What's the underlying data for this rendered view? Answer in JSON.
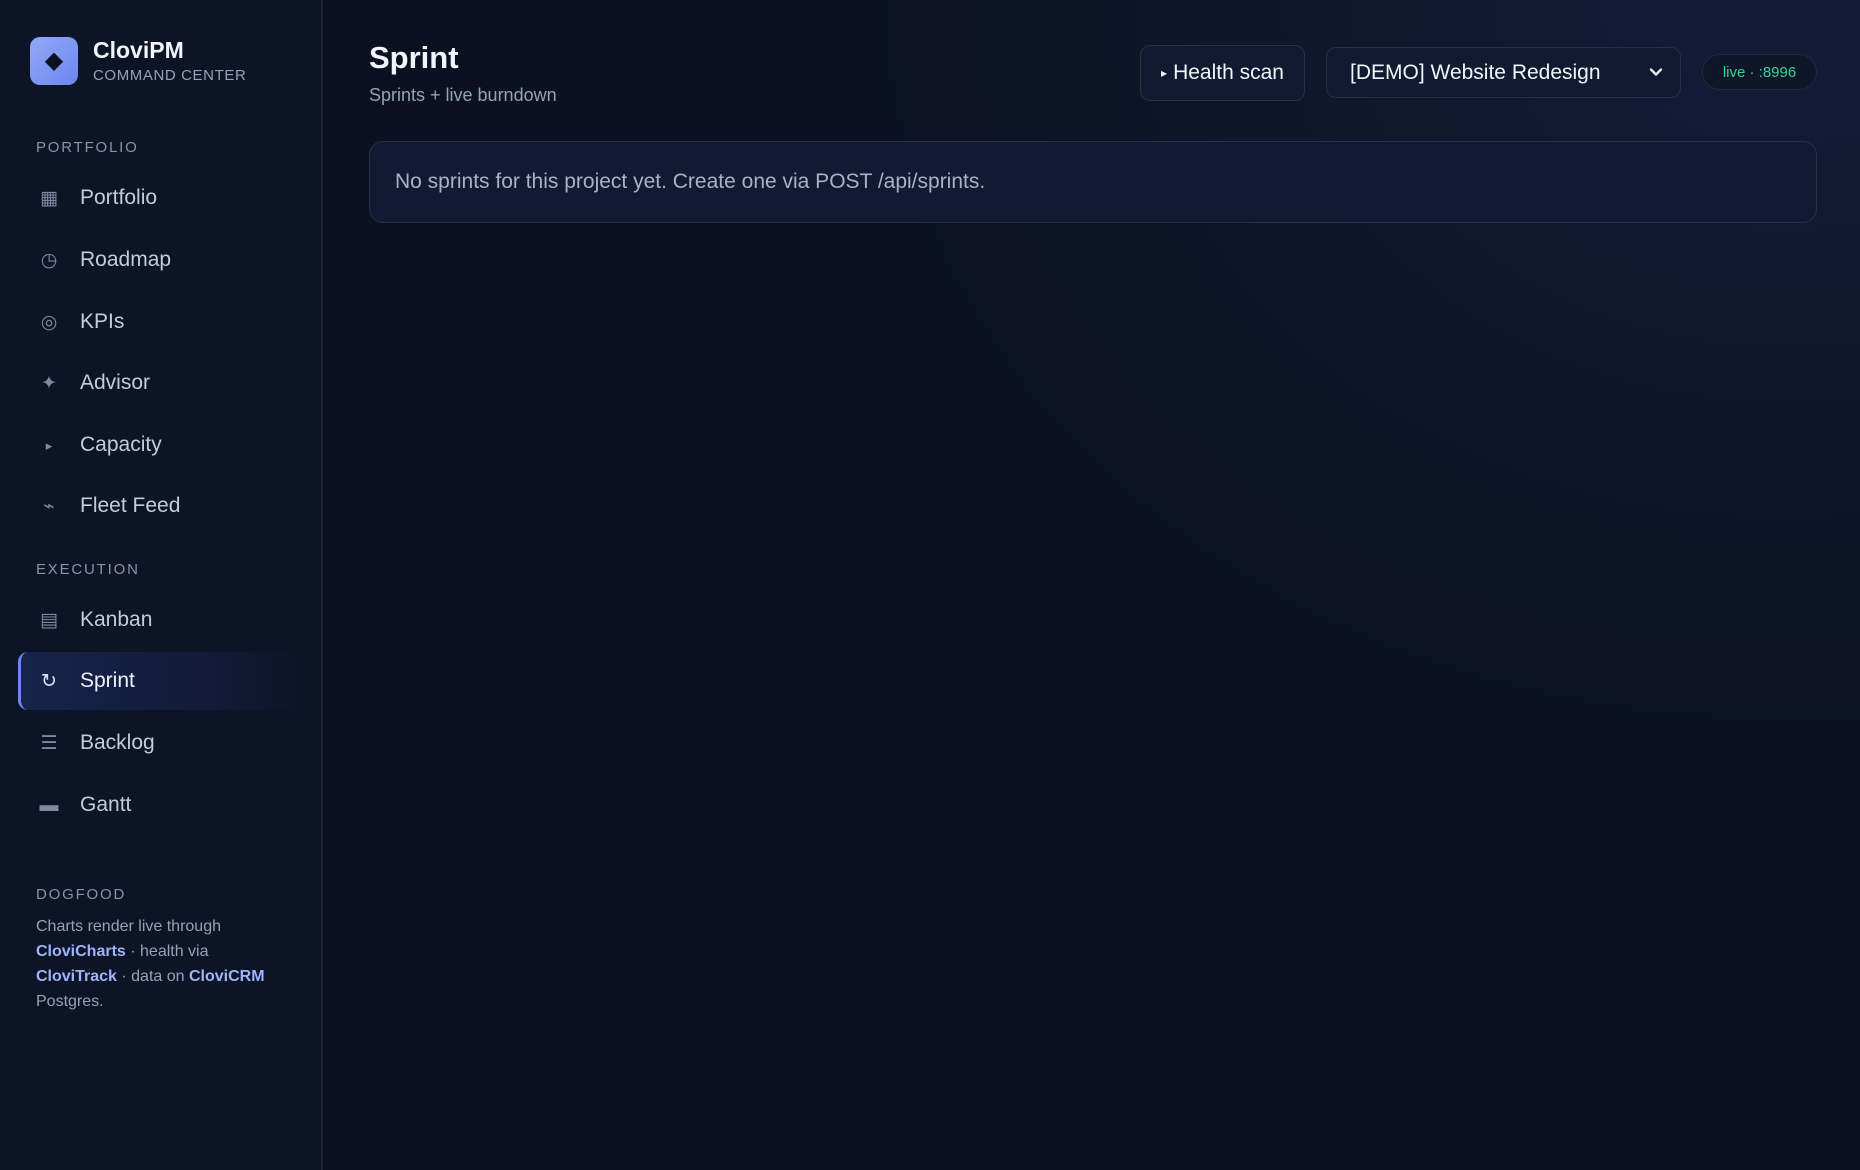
{
  "brand": {
    "logo_glyph": "◆",
    "name": "CloviPM",
    "subtitle": "COMMAND CENTER"
  },
  "sidebar": {
    "sections": [
      {
        "label": "PORTFOLIO",
        "items": [
          {
            "label": "Portfolio",
            "icon": "grid-icon",
            "glyph": "▦"
          },
          {
            "label": "Roadmap",
            "icon": "clock-icon",
            "glyph": "◷"
          },
          {
            "label": "KPIs",
            "icon": "target-icon",
            "glyph": "◎"
          },
          {
            "label": "Advisor",
            "icon": "sparkle-icon",
            "glyph": "✦"
          },
          {
            "label": "Capacity",
            "icon": "play-icon",
            "glyph": "▸"
          },
          {
            "label": "Fleet Feed",
            "icon": "pulse-icon",
            "glyph": "⌁"
          }
        ]
      },
      {
        "label": "EXECUTION",
        "items": [
          {
            "label": "Kanban",
            "icon": "board-icon",
            "glyph": "▤"
          },
          {
            "label": "Sprint",
            "icon": "refresh-icon",
            "glyph": "↻",
            "active": true
          },
          {
            "label": "Backlog",
            "icon": "list-icon",
            "glyph": "☰"
          },
          {
            "label": "Gantt",
            "icon": "bar-icon",
            "glyph": "▬"
          }
        ]
      }
    ],
    "dogfood": {
      "label": "DOGFOOD",
      "text_1": "Charts render live through",
      "link_1": "CloviCharts",
      "text_2": " · health via ",
      "link_2": "CloviTrack",
      "text_3": " · data on ",
      "link_3": "CloviCRM",
      "text_4": " Postgres."
    }
  },
  "header": {
    "title": "Sprint",
    "subtitle": "Sprints + live burndown",
    "health_button_label": "Health scan",
    "health_button_glyph": "▸",
    "project_select_value": "[DEMO] Website Redesign",
    "live_badge": "live · :8996"
  },
  "main": {
    "empty_message": "No sprints for this project yet. Create one via POST /api/sprints."
  },
  "colors": {
    "accent": "#6d86f0",
    "live": "#34d399",
    "background": "#0b1120"
  }
}
